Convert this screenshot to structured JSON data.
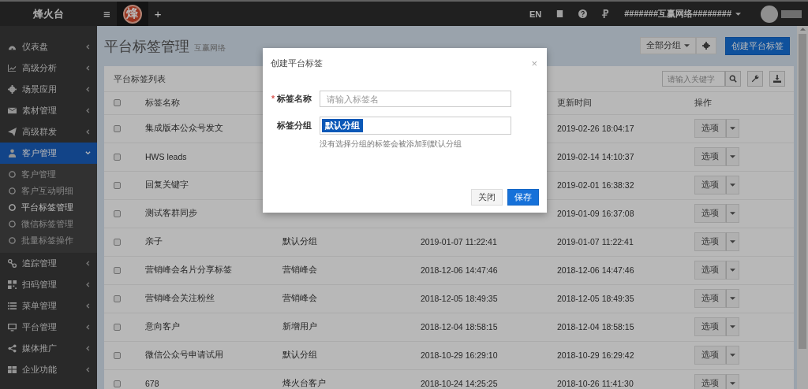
{
  "topbar": {
    "brand": "烽火台",
    "menu": "≡",
    "logo": "烽",
    "add": "+",
    "lang": "EN",
    "user": "#######互赢网络########"
  },
  "sidebar": {
    "items": [
      {
        "label": "仪表盘",
        "selected": false,
        "expanded": false
      },
      {
        "label": "高级分析",
        "selected": false,
        "expanded": false
      },
      {
        "label": "场景应用",
        "selected": false,
        "expanded": false
      },
      {
        "label": "素材管理",
        "selected": false,
        "expanded": false
      },
      {
        "label": "高级群发",
        "selected": false,
        "expanded": false
      },
      {
        "label": "客户管理",
        "selected": true,
        "expanded": true,
        "children": [
          {
            "label": "客户管理",
            "selected": false
          },
          {
            "label": "客户互动明细",
            "selected": false
          },
          {
            "label": "平台标签管理",
            "selected": true
          },
          {
            "label": "微信标签管理",
            "selected": false
          },
          {
            "label": "批量标签操作",
            "selected": false
          }
        ]
      },
      {
        "label": "追踪管理",
        "selected": false,
        "expanded": false
      },
      {
        "label": "扫码管理",
        "selected": false,
        "expanded": false
      },
      {
        "label": "菜单管理",
        "selected": false,
        "expanded": false
      },
      {
        "label": "平台管理",
        "selected": false,
        "expanded": false
      },
      {
        "label": "媒体推广",
        "selected": false,
        "expanded": false
      },
      {
        "label": "企业功能",
        "selected": false,
        "expanded": false
      }
    ]
  },
  "page": {
    "title": "平台标签管理",
    "subtitle": "互赢网络",
    "group_filter": "全部分组",
    "create_button": "创建平台标签"
  },
  "panel": {
    "title": "平台标签列表",
    "search": {
      "placeholder": "请输入关键字"
    }
  },
  "table": {
    "header": {
      "checked": false,
      "name": "标签名称",
      "updated": "更新时间",
      "actions": "操作"
    },
    "rows": [
      {
        "checked": false,
        "name": "集成版本公众号发文",
        "updated": "2019-02-26 18:04:17",
        "action": "选项"
      },
      {
        "checked": false,
        "name": "HWS leads",
        "updated": "2019-02-14 14:10:37",
        "action": "选项"
      },
      {
        "checked": false,
        "name": "回复关键字",
        "updated": "2019-02-01 16:38:32",
        "action": "选项"
      },
      {
        "checked": false,
        "name": "测试客群同步",
        "updated": "2019-01-09 16:37:08",
        "action": "选项"
      },
      {
        "checked": false,
        "name": "亲子",
        "group": "默认分组",
        "created": "2019-01-07 11:22:41",
        "updated": "2019-01-07 11:22:41",
        "action": "选项"
      },
      {
        "checked": false,
        "name": "营销峰会名片分享标签",
        "group": "营销峰会",
        "created": "2018-12-06 14:47:46",
        "updated": "2018-12-06 14:47:46",
        "action": "选项"
      },
      {
        "checked": false,
        "name": "营销峰会关注粉丝",
        "group": "营销峰会",
        "created": "2018-12-05 18:49:35",
        "updated": "2018-12-05 18:49:35",
        "action": "选项"
      },
      {
        "checked": false,
        "name": "意向客户",
        "group": "新增用户",
        "created": "2018-12-04 18:58:15",
        "updated": "2018-12-04 18:58:15",
        "action": "选项"
      },
      {
        "checked": false,
        "name": "微信公众号申请试用",
        "group": "默认分组",
        "created": "2018-10-29 16:29:10",
        "updated": "2018-10-29 16:29:42",
        "action": "选项"
      },
      {
        "checked": false,
        "name": "678",
        "group": "烽火台客户",
        "created": "2018-10-24 14:25:25",
        "updated": "2018-10-26 11:41:30",
        "action": "选项"
      }
    ]
  },
  "modal": {
    "title": "创建平台标签",
    "close": "×",
    "fields": [
      {
        "kind": "text",
        "label": "标签名称",
        "required_mark": "*",
        "placeholder": "请输入标签名"
      },
      {
        "kind": "tags",
        "label": "标签分组",
        "tags": [
          "默认分组"
        ],
        "help": "没有选择分组的标签会被添加到默认分组"
      }
    ],
    "buttons": [
      {
        "label": "关闭",
        "kind": "default"
      },
      {
        "label": "保存",
        "kind": "primary"
      }
    ]
  }
}
